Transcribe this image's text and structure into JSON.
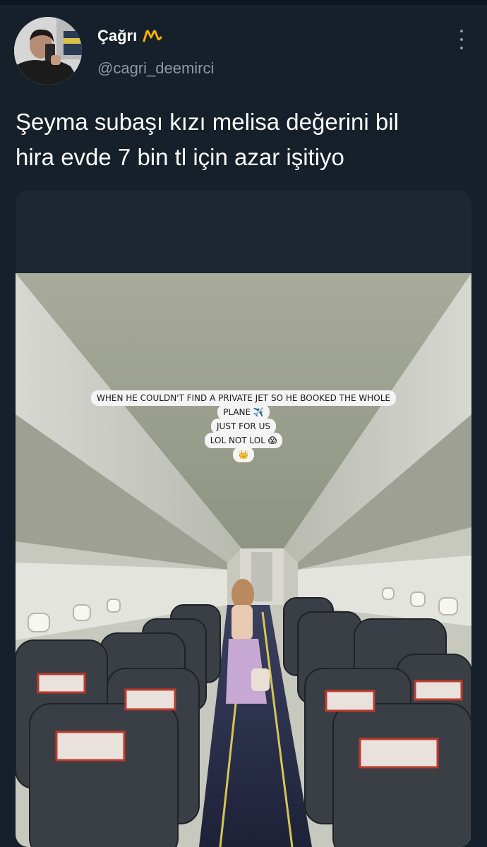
{
  "tweet": {
    "display_name": "Çağrı",
    "badge_emoji": "〽",
    "username": "@cagri_deemirci",
    "text": "Şeyma subaşı kızı melisa değerini bil\nhira evde 7 bin tl için azar işitiyo",
    "more_icon": "more-vertical-icon"
  },
  "media": {
    "caption_lines": [
      "WHEN HE COULDN'T FIND A PRIVATE JET SO HE BOOKED THE WHOLE",
      "PLANE ✈️",
      "JUST FOR US",
      "LOL NOT LOL 😱",
      "👑"
    ]
  },
  "colors": {
    "background": "#15202b",
    "secondary_text": "#8b98a5",
    "badge": "#f5b100"
  }
}
